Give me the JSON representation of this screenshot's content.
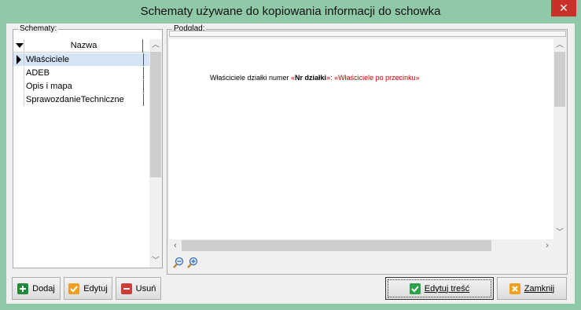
{
  "window": {
    "title": "Schematy używane do kopiowania informacji do schowka",
    "close_label": "✕"
  },
  "schemas": {
    "group_label": "Schematy:",
    "column_header": "Nazwa",
    "items": [
      {
        "label": "Właściciele",
        "selected": true
      },
      {
        "label": "ADEB",
        "selected": false
      },
      {
        "label": "Opis i mapa",
        "selected": false
      },
      {
        "label": "SprawozdanieTechniczne",
        "selected": false
      }
    ]
  },
  "preview": {
    "group_label": "Podgląd:",
    "text_prefix": "Właściciele działki numer ",
    "field1_open": "«",
    "field1_name": "Nr działki",
    "field1_close": "»",
    "separator": ": ",
    "field2": "«Właściciele po przecinku»"
  },
  "buttons": {
    "add": "Dodaj",
    "edit": "Edytuj",
    "delete": "Usuń",
    "edit_content": "Edytuj treść",
    "close": "Zamknij"
  },
  "colors": {
    "titlebar": "#8fc9a8",
    "close_button": "#c7312a",
    "field_marker": "#cc0000",
    "add_icon": "#1f8a3b",
    "edit_icon": "#f0a020",
    "delete_icon": "#d23a3a"
  },
  "icons": {
    "add": "plus-icon",
    "edit": "pencil-check-icon",
    "delete": "minus-icon",
    "edit_content": "checkmark-icon",
    "close": "x-icon",
    "zoom_out": "zoom-out-icon",
    "zoom_in": "zoom-in-icon"
  }
}
